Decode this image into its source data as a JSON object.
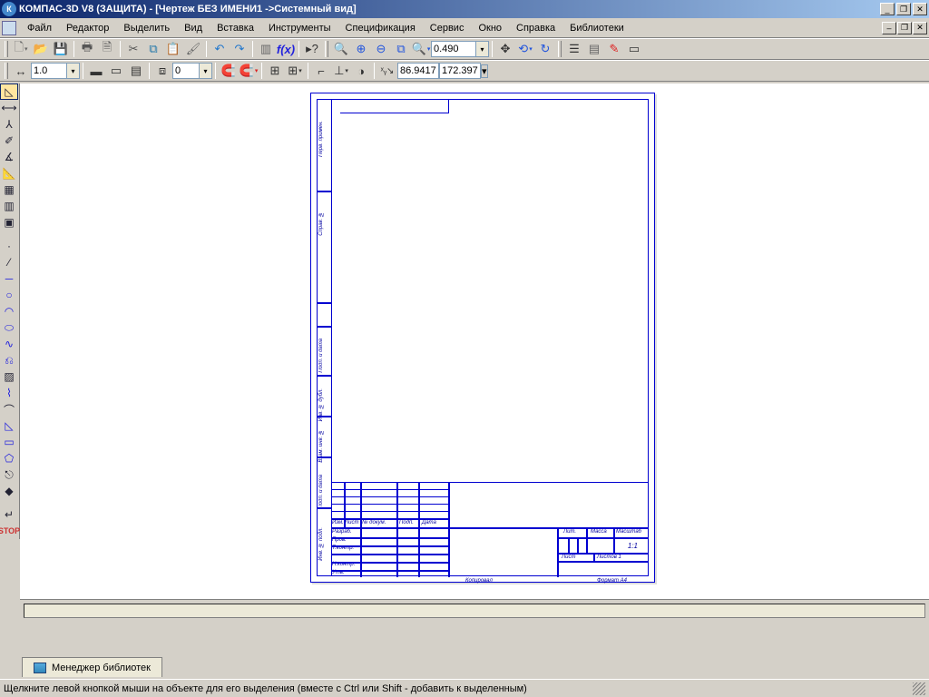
{
  "title": "КОМПАС-3D V8 (ЗАЩИТА) - [Чертеж БЕЗ ИМЕНИ1 ->Системный вид]",
  "menu": [
    "Файл",
    "Редактор",
    "Выделить",
    "Вид",
    "Вставка",
    "Инструменты",
    "Спецификация",
    "Сервис",
    "Окно",
    "Справка",
    "Библиотеки"
  ],
  "toolbar1": {
    "zoom_value": "0.490"
  },
  "toolbar2": {
    "line_weight": "1.0",
    "layer": "0",
    "coord_x": "86.9417",
    "coord_y": "172.397"
  },
  "drawing": {
    "left_strip_labels": [
      "Перв. примен.",
      "Справ. №",
      "Подп. и дата",
      "Инв. № дубл.",
      "Взам. инв. №",
      "Подп. и дата",
      "Инв. № подл."
    ],
    "titleblock_cols": [
      "Изм.",
      "Лист",
      "№ докум.",
      "Подп.",
      "Дата"
    ],
    "titleblock_rows": [
      "Разраб.",
      "Пров.",
      "Т.контр.",
      "Н.контр.",
      "Утв."
    ],
    "right_cols": [
      "Лит.",
      "Масса",
      "Масштаб"
    ],
    "scale": "1:1",
    "sheet_label": "Лист",
    "sheets_label": "Листов 1",
    "footer_center": "Копировал",
    "footer_right": "Формат    A4"
  },
  "library_tab": "Менеджер библиотек",
  "status": "Щелкните левой кнопкой мыши на объекте для его выделения (вместе с Ctrl или Shift - добавить к выделенным)"
}
